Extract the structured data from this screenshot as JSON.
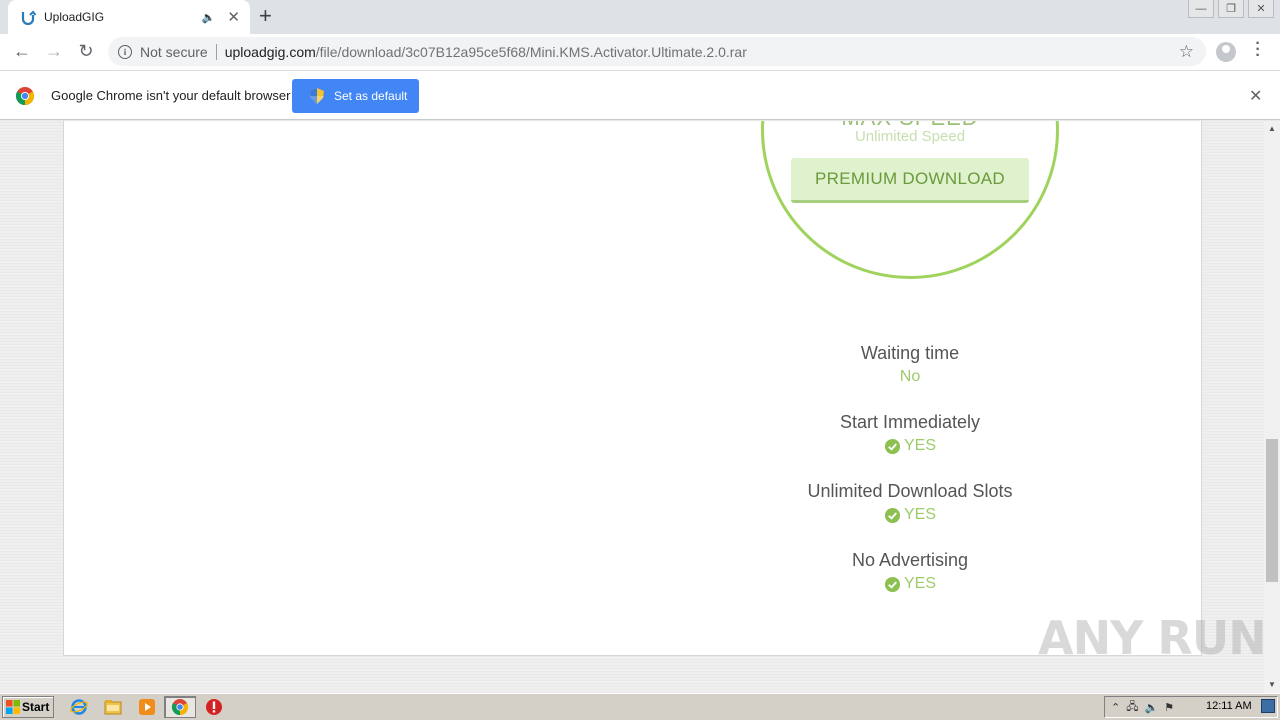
{
  "browser": {
    "tab": {
      "title": "UploadGIG"
    },
    "address": {
      "security_label": "Not secure",
      "host": "uploadgig.com",
      "path": "/file/download/3c07B12a95ce5f68/Mini.KMS.Activator.Ultimate.2.0.rar"
    },
    "infobar": {
      "message": "Google Chrome isn't your default browser",
      "button_label": "Set as default"
    }
  },
  "page": {
    "plan_title": "MAX SPEED",
    "plan_subtitle": "Unlimited Speed",
    "premium_button": "PREMIUM DOWNLOAD",
    "features": [
      {
        "title": "Waiting time",
        "value": "No"
      },
      {
        "title": "Start Immediately",
        "value": "YES"
      },
      {
        "title": "Unlimited Download Slots",
        "value": "YES"
      },
      {
        "title": "No Advertising",
        "value": "YES"
      }
    ],
    "accent_color": "#9fd35c"
  },
  "watermark": "ANY RUN",
  "taskbar": {
    "start_label": "Start",
    "clock": "12:11 AM"
  }
}
